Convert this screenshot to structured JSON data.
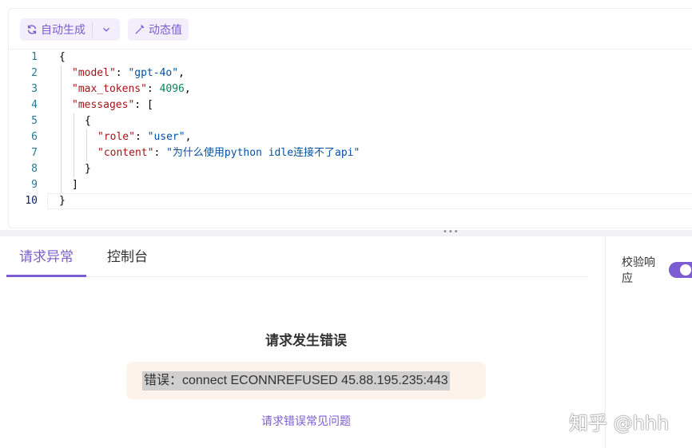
{
  "toolbar": {
    "auto_generate_label": "自动生成",
    "auto_generate_icon": "refresh-icon",
    "dropdown_icon": "chevron-down-icon",
    "dynamic_value_label": "动态值",
    "dynamic_value_icon": "magic-wand-icon"
  },
  "editor": {
    "line_numbers": [
      "1",
      "2",
      "3",
      "4",
      "5",
      "6",
      "7",
      "8",
      "9",
      "10"
    ],
    "active_line": "10",
    "lines": [
      {
        "text": "{"
      },
      {
        "key": "\"model\"",
        "sep": ": ",
        "str": "\"gpt-4o\"",
        "end": ","
      },
      {
        "key": "\"max_tokens\"",
        "sep": ": ",
        "num": "4096",
        "end": ","
      },
      {
        "key": "\"messages\"",
        "sep": ": ",
        "end": "["
      },
      {
        "text": "{"
      },
      {
        "key": "\"role\"",
        "sep": ": ",
        "str": "\"user\"",
        "end": ","
      },
      {
        "key": "\"content\"",
        "sep": ": ",
        "str": "\"为什么使用python idle连接不了api\"",
        "end": ""
      },
      {
        "text": "}"
      },
      {
        "text": "]"
      },
      {
        "text": "}"
      }
    ]
  },
  "tabs": [
    {
      "label": "请求异常",
      "active": true
    },
    {
      "label": "控制台",
      "active": false
    }
  ],
  "side": {
    "validate_label": "校验响应",
    "validate_on": true
  },
  "error": {
    "title": "请求发生错误",
    "message": "错误：connect ECONNREFUSED 45.88.195.235:443",
    "faq_link": "请求错误常见问题"
  },
  "watermark": "知乎 @hhh",
  "colors": {
    "accent": "#7b5cd1",
    "error_bg": "#fdf3ea"
  }
}
